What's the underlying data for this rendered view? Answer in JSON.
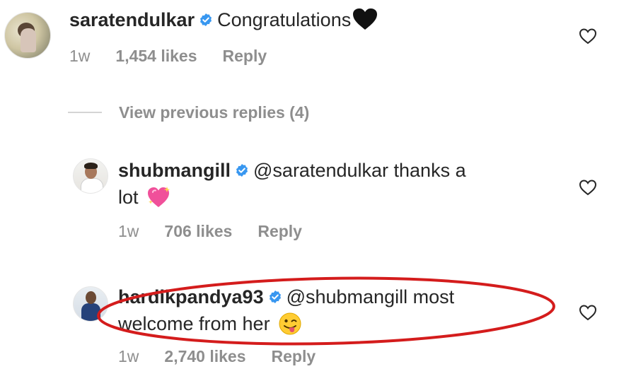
{
  "comments": [
    {
      "username": "saratendulkar",
      "text": "Congratulations",
      "emoji": "black-heart",
      "time": "1w",
      "likes": "1,454 likes",
      "reply": "Reply"
    },
    {
      "username": "shubmangill",
      "text_line1": "@saratendulkar thanks a",
      "text_line2": "lot",
      "emoji": "sparkling-heart",
      "time": "1w",
      "likes": "706 likes",
      "reply": "Reply"
    },
    {
      "username": "hardikpandya93",
      "text_line1": "@shubmangill most",
      "text_line2": "welcome from her",
      "emoji": "winking-tongue-face",
      "time": "1w",
      "likes": "2,740 likes",
      "reply": "Reply"
    }
  ],
  "view_previous": "View previous replies (4)",
  "colors": {
    "text": "#262626",
    "meta": "#8e8e8e",
    "verified": "#3897f0",
    "highlight": "#d41c1c"
  }
}
